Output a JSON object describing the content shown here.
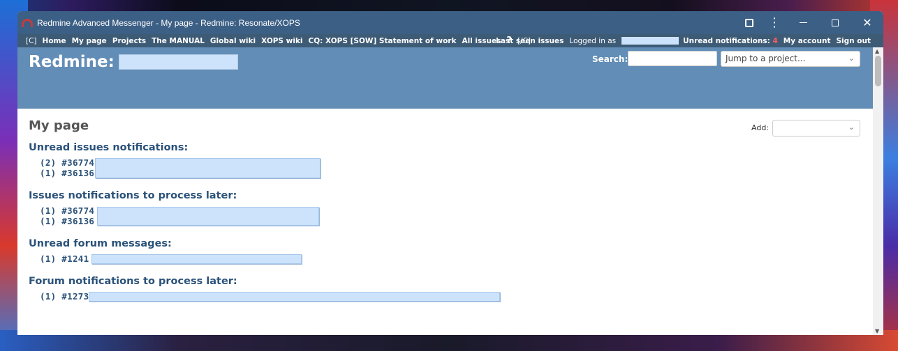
{
  "window": {
    "title": "Redmine Advanced Messenger - My page - Redmine: Resonate/XOPS",
    "minimize": "",
    "close": "✕"
  },
  "top_menu": {
    "left_items": [
      "[C]",
      "Home",
      "My page",
      "Projects",
      "The MANUAL",
      "Global wiki",
      "XOPS wiki",
      "CQ: XOPS [SOW] Statement of work",
      "All issues",
      "?",
      "[/C]"
    ],
    "last_seen": "Last seen issues",
    "logged_in_as": "Logged in as",
    "unread_label": "Unread notifications:",
    "unread_count": "4",
    "my_account": "My account",
    "sign_out": "Sign out"
  },
  "header": {
    "title": "Redmine:",
    "search_label": "Search:",
    "search_value": "",
    "jump_placeholder": "Jump to a project..."
  },
  "main": {
    "page_title": "My page",
    "add_label": "Add:",
    "sections": [
      {
        "heading": "Unread issues notifications:",
        "items": [
          "(2) #36774",
          "(1) #36136"
        ]
      },
      {
        "heading": "Issues notifications to process later:",
        "items": [
          "(1) #36774",
          "(1) #36136"
        ]
      },
      {
        "heading": "Unread forum messages:",
        "items": [
          "(1) #1241"
        ]
      },
      {
        "heading": "Forum notifications to process later:",
        "items": [
          "(1) #1273"
        ]
      }
    ]
  },
  "colors": {
    "titlebar": "#3c5f85",
    "topmenu": "#3e5b76",
    "header": "#628db6",
    "link": "#2b5279",
    "redaction": "#cce3fb",
    "unread_count": "#ff5c5c"
  }
}
